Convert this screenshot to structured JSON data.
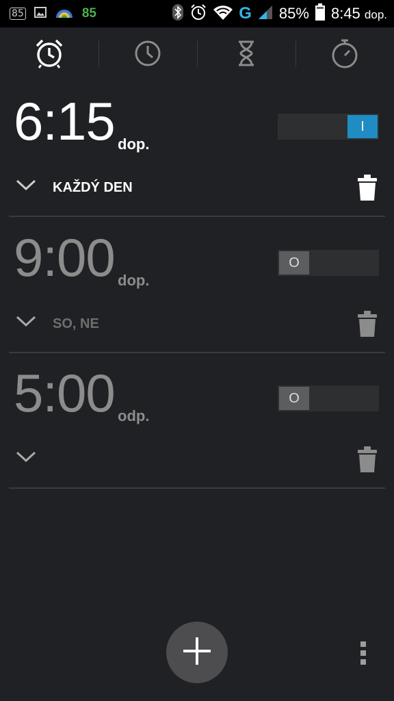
{
  "statusbar": {
    "notif_badge": "85",
    "notif_number": "85",
    "network_letter": "G",
    "battery": "85%",
    "time": "8:45",
    "time_suffix": "dop.",
    "icons": [
      "notification-badge-icon",
      "image-icon",
      "weather-icon",
      "bluetooth-icon",
      "alarm-icon",
      "wifi-icon",
      "signal-icon",
      "battery-icon"
    ]
  },
  "tabs": [
    {
      "name": "alarm",
      "icon": "alarm-clock-icon",
      "selected": true
    },
    {
      "name": "clock",
      "icon": "clock-icon",
      "selected": false
    },
    {
      "name": "timer",
      "icon": "hourglass-icon",
      "selected": false
    },
    {
      "name": "stopwatch",
      "icon": "stopwatch-icon",
      "selected": false
    }
  ],
  "alarms": [
    {
      "time": "6:15",
      "ampm": "dop.",
      "enabled": true,
      "toggle_label": "I",
      "days": "KAŽDÝ DEN"
    },
    {
      "time": "9:00",
      "ampm": "dop.",
      "enabled": false,
      "toggle_label": "O",
      "days": "SO, NE"
    },
    {
      "time": "5:00",
      "ampm": "odp.",
      "enabled": false,
      "toggle_label": "O",
      "days": ""
    }
  ],
  "colors": {
    "background": "#202124",
    "accent_on": "#1f8dc3",
    "divider": "#3a3b3d"
  }
}
